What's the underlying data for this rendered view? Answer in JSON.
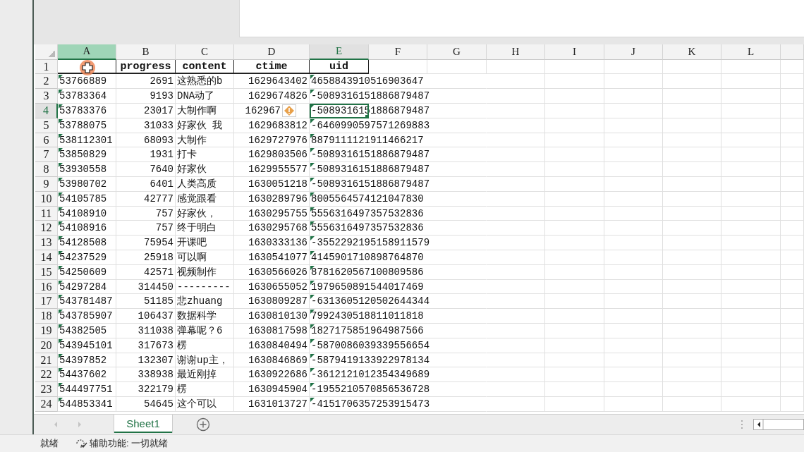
{
  "columns": [
    {
      "letter": "A",
      "selected": true,
      "active": false,
      "text_flag": true
    },
    {
      "letter": "B",
      "selected": false,
      "active": false,
      "text_flag": false
    },
    {
      "letter": "C",
      "selected": false,
      "active": false,
      "text_flag": false
    },
    {
      "letter": "D",
      "selected": false,
      "active": false,
      "text_flag": false
    },
    {
      "letter": "E",
      "selected": false,
      "active": true,
      "text_flag": true
    },
    {
      "letter": "F",
      "selected": false,
      "active": false
    },
    {
      "letter": "G",
      "selected": false,
      "active": false
    },
    {
      "letter": "H",
      "selected": false,
      "active": false
    },
    {
      "letter": "I",
      "selected": false,
      "active": false
    },
    {
      "letter": "J",
      "selected": false,
      "active": false
    },
    {
      "letter": "K",
      "selected": false,
      "active": false
    },
    {
      "letter": "L",
      "selected": false,
      "active": false
    }
  ],
  "header_row": {
    "num": "1",
    "active": false,
    "cells": [
      null,
      "progress",
      "content",
      "ctime",
      "uid"
    ]
  },
  "rows": [
    {
      "num": "2",
      "active": false,
      "warning": false,
      "cells": [
        "53766889",
        "2691",
        "这熟悉的b",
        "1629643402",
        "4658843910516903647"
      ]
    },
    {
      "num": "3",
      "active": false,
      "warning": false,
      "cells": [
        "53783364",
        "9193",
        "DNA动了",
        "1629674826",
        "-5089316151886879487"
      ]
    },
    {
      "num": "4",
      "active": true,
      "warning": true,
      "cells": [
        "53783376",
        "23017",
        "大制作啊",
        "162967",
        "-5089316151886879487"
      ]
    },
    {
      "num": "5",
      "active": false,
      "warning": false,
      "cells": [
        "53788075",
        "31033",
        "好家伙 我",
        "1629683812",
        "-6460990597571269883"
      ]
    },
    {
      "num": "6",
      "active": false,
      "warning": false,
      "cells": [
        "538112301",
        "68093",
        "大制作",
        "1629727976",
        "8879111121911466217"
      ]
    },
    {
      "num": "7",
      "active": false,
      "warning": false,
      "cells": [
        "53850829",
        "1931",
        "打卡",
        "1629803506",
        "-5089316151886879487"
      ]
    },
    {
      "num": "8",
      "active": false,
      "warning": false,
      "cells": [
        "53930558",
        "7640",
        "好家伙",
        "1629955577",
        "-5089316151886879487"
      ]
    },
    {
      "num": "9",
      "active": false,
      "warning": false,
      "cells": [
        "53980702",
        "6401",
        "人类高质",
        "1630051218",
        "-5089316151886879487"
      ]
    },
    {
      "num": "10",
      "active": false,
      "warning": false,
      "cells": [
        "54105785",
        "42777",
        "感觉跟看",
        "1630289796",
        "8005564574121047830"
      ]
    },
    {
      "num": "11",
      "active": false,
      "warning": false,
      "cells": [
        "54108910",
        "757",
        "好家伙，",
        "1630295755",
        "5556316497357532836"
      ]
    },
    {
      "num": "12",
      "active": false,
      "warning": false,
      "cells": [
        "54108916",
        "757",
        "终于明白",
        "1630295768",
        "5556316497357532836"
      ]
    },
    {
      "num": "13",
      "active": false,
      "warning": false,
      "cells": [
        "54128508",
        "75954",
        "开课吧",
        "1630333136",
        "-3552292195158911579"
      ]
    },
    {
      "num": "14",
      "active": false,
      "warning": false,
      "cells": [
        "54237529",
        "25918",
        "可以啊",
        "1630541077",
        "4145901710898764870"
      ]
    },
    {
      "num": "15",
      "active": false,
      "warning": false,
      "cells": [
        "54250609",
        "42571",
        "视频制作",
        "1630566026",
        "8781620567100809586"
      ]
    },
    {
      "num": "16",
      "active": false,
      "warning": false,
      "cells": [
        "54297284",
        "314450",
        "---------",
        "1630655052",
        "1979650891544017469"
      ]
    },
    {
      "num": "17",
      "active": false,
      "warning": false,
      "cells": [
        "543781487",
        "51185",
        "悲zhuang",
        "1630809287",
        "-6313605120502644344"
      ]
    },
    {
      "num": "18",
      "active": false,
      "warning": false,
      "cells": [
        "543785907",
        "106437",
        "数据科学",
        "1630810130",
        "7992430518811011818"
      ]
    },
    {
      "num": "19",
      "active": false,
      "warning": false,
      "cells": [
        "54382505",
        "311038",
        "弹幕呢？6",
        "1630817598",
        "1827175851964987566"
      ]
    },
    {
      "num": "20",
      "active": false,
      "warning": false,
      "cells": [
        "543945101",
        "317673",
        "楞",
        "1630840494",
        "-5870086039339556654"
      ]
    },
    {
      "num": "21",
      "active": false,
      "warning": false,
      "cells": [
        "54397852",
        "132307",
        "谢谢up主，",
        "1630846869",
        "-5879419133922978134"
      ]
    },
    {
      "num": "22",
      "active": false,
      "warning": false,
      "cells": [
        "54437602",
        "338938",
        "最近刚掉",
        "1630922686",
        "-3612121012354349689"
      ]
    },
    {
      "num": "23",
      "active": false,
      "warning": false,
      "cells": [
        "544497751",
        "322179",
        "楞",
        "1630945904",
        "-1955210570856536728"
      ]
    },
    {
      "num": "24",
      "active": false,
      "warning": false,
      "cells": [
        "544853341",
        "54645",
        "这个可以",
        "1631013727",
        "-4151706357253915473"
      ]
    }
  ],
  "sheet_tabs": [
    {
      "label": "Sheet1",
      "selected": true
    }
  ],
  "status_bar": {
    "ready": "就绪",
    "accessibility": "辅助功能: 一切就绪"
  }
}
